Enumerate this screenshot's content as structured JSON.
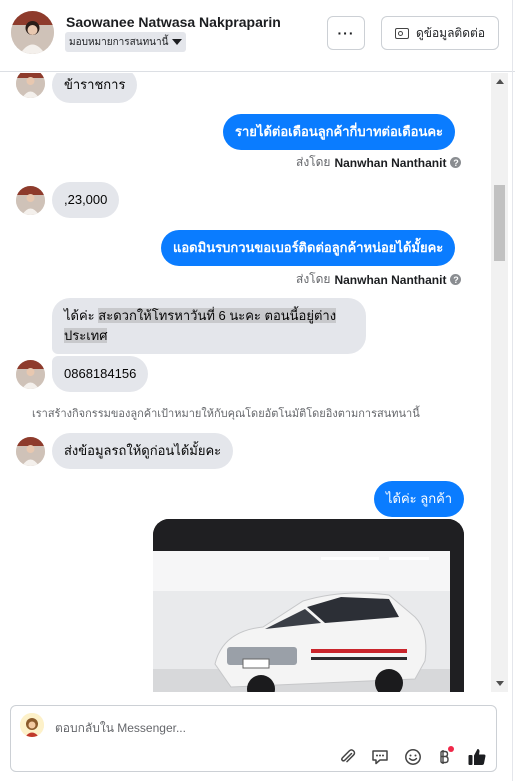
{
  "header": {
    "name": "Saowanee Natwasa Nakpraparin",
    "assign_label": "มอบหมายการสนทนานี้",
    "more_label": "···",
    "contact_label": "ดูข้อมูลติดต่อ"
  },
  "messages": {
    "m1": "ข้าราชการ",
    "m2": "รายได้ต่อเดือนลูกค้ากี่บาทต่อเดือนคะ",
    "m2_sent_prefix": "ส่งโดย",
    "m2_sent_name": "Nanwhan Nanthanit",
    "m3": ",23,000",
    "m4": "แอดมินรบกวนขอเบอร์ติดต่อลูกค้าหน่อยได้มั้ยคะ",
    "m4_sent_prefix": "ส่งโดย",
    "m4_sent_name": "Nanwhan Nanthanit",
    "m5_line1_a": "ได้ค่ะ",
    "m5_line1_b": "สะดวกให้โทรหาวันที่ 6 นะคะ  ตอนนี้อยู่ต่าง",
    "m5_line2": "ประเทศ",
    "m6": "0868184156",
    "notice": "เราสร้างกิจกรรมของลูกค้าเป้าหมายให้กับคุณโดยอัตโนมัติโดยอิงตามการสนทนานี้",
    "m7": "ส่งข้อมูลรถให้ดูก่อนได้มั้ยคะ",
    "m8": "ได้ค่ะ ลูกค้า"
  },
  "composer": {
    "placeholder": "ตอบกลับใน Messenger..."
  },
  "colors": {
    "outgoing_bubble": "#0a7cff",
    "incoming_bubble": "#e4e6eb",
    "like_thumb": "#1c1e21",
    "notification_dot": "#f02849"
  },
  "icons": [
    "more-icon",
    "id-card-icon",
    "help-icon",
    "attachment-icon",
    "chat-bubble-icon",
    "emoji-icon",
    "baht-icon",
    "thumbs-up-icon"
  ]
}
